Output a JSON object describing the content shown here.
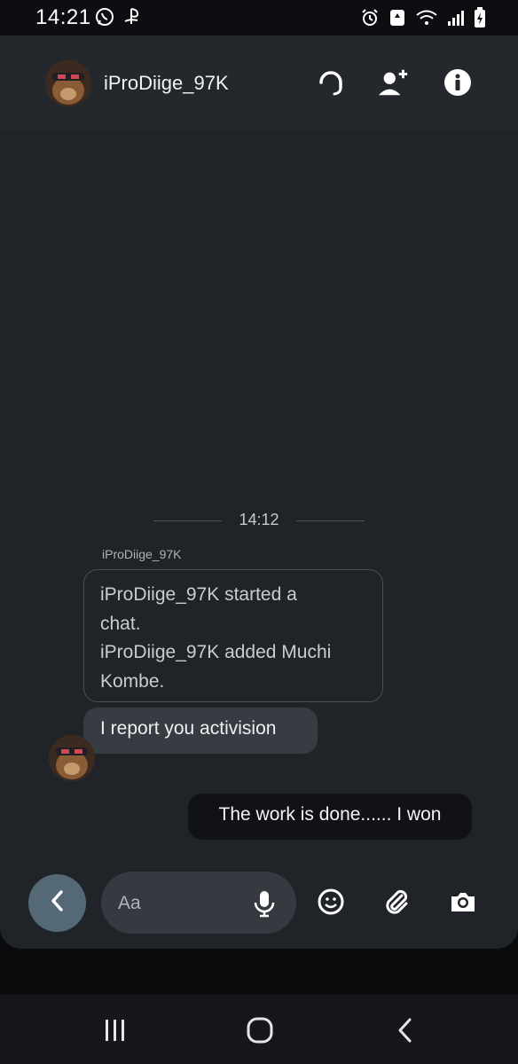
{
  "status_bar": {
    "time": "14:21",
    "left_icons": [
      "whatsapp-icon",
      "playstation-icon"
    ],
    "right_icons": [
      "alarm-icon",
      "recycle-icon",
      "wifi-icon",
      "signal-icon",
      "battery-charging-icon"
    ]
  },
  "header": {
    "title": "iProDiige_97K",
    "actions": [
      "headset-icon",
      "add-person-icon",
      "info-icon"
    ]
  },
  "chat": {
    "timestamp": "14:12",
    "sender_name": "iProDiige_97K",
    "system_message_lines": [
      "iProDiige_97K started a",
      "chat.",
      "iProDiige_97K added Muchi",
      "Kombe."
    ],
    "incoming_message": "I report you activision",
    "outgoing_message": "The work is done...... I won"
  },
  "composer": {
    "placeholder": "Aa",
    "icons": [
      "back-chevron-icon",
      "microphone-icon",
      "emoji-icon",
      "attachment-icon",
      "camera-icon"
    ]
  },
  "nav_bar": {
    "buttons": [
      "recent-apps-icon",
      "home-icon",
      "back-icon"
    ]
  },
  "colors": {
    "app_background": "#202328",
    "header_background": "#24272c",
    "incoming_bubble": "#373b42",
    "outgoing_bubble": "#101215",
    "back_button": "#546975"
  }
}
